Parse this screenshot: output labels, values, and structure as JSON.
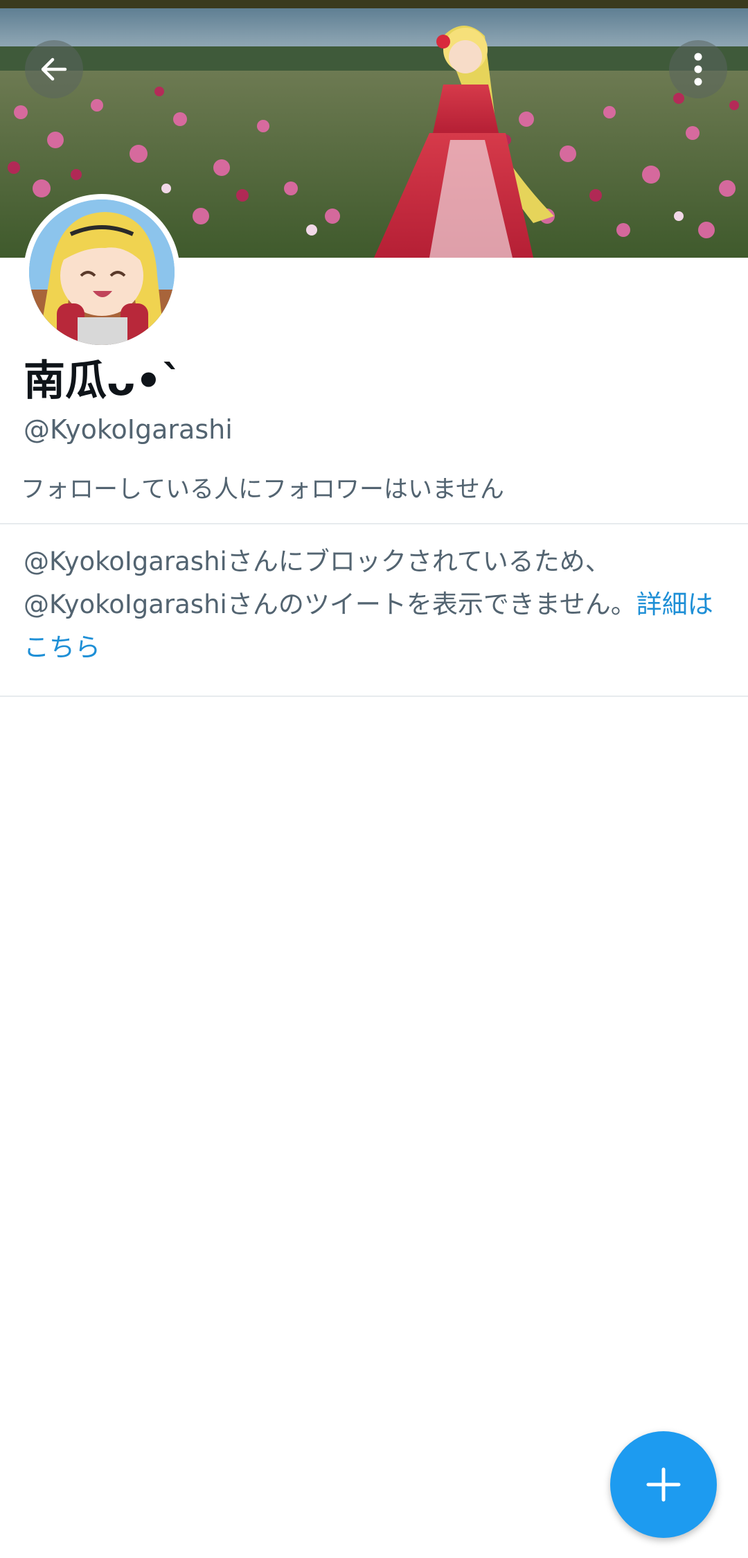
{
  "header": {
    "back_icon": "arrow-left-icon",
    "more_icon": "vertical-dots-icon"
  },
  "profile": {
    "display_name": "南瓜ᴗ•`",
    "handle": "@KyokoIgarashi",
    "followers_note": "フォローしている人にフォロワーはいません",
    "avatar_icon": "avatar-image",
    "banner_icon": "banner-image"
  },
  "blocked": {
    "message": "@KyokoIgarashiさんにブロックされているため、@KyokoIgarashiさんのツイートを表示できません。",
    "link_text": "詳細はこちら"
  },
  "fab": {
    "icon": "plus-icon"
  },
  "colors": {
    "accent": "#1d9bf0",
    "secondary_text": "#536471",
    "primary_text": "#0f1419",
    "divider": "#e7ebee"
  }
}
